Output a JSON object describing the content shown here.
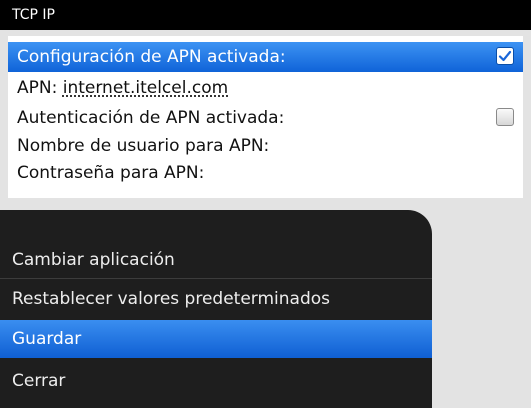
{
  "titlebar": {
    "title": "TCP IP"
  },
  "settings": {
    "apn_config_label": "Configuración de APN activada:",
    "apn_config_checked": true,
    "apn_label": "APN:",
    "apn_value": "internet.itelcel.com",
    "apn_auth_label": "Autenticación de APN activada:",
    "apn_auth_checked": false,
    "username_label": "Nombre de usuario para APN:",
    "password_label": "Contraseña para APN:"
  },
  "menu": {
    "items": [
      {
        "label": "Cambiar aplicación"
      },
      {
        "label": "Restablecer valores predeterminados"
      },
      {
        "label": "Guardar",
        "selected": true
      },
      {
        "label": "Cerrar"
      }
    ]
  },
  "colors": {
    "selection": "#1f74e6",
    "menu_background": "#1e1e1e",
    "titlebar": "#000000"
  }
}
